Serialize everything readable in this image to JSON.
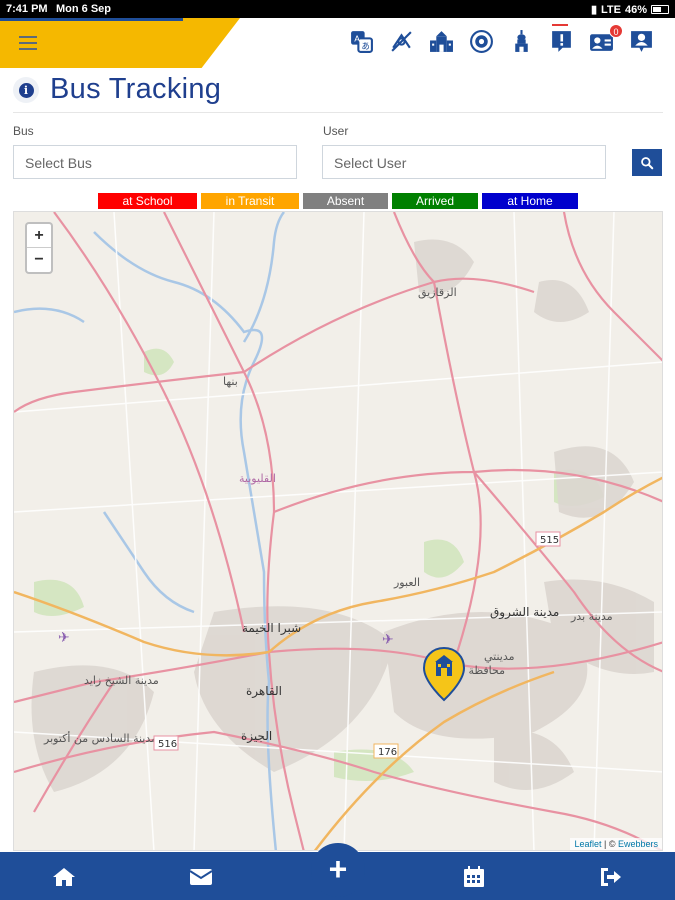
{
  "status_bar": {
    "time": "7:41 PM",
    "date": "Mon 6 Sep",
    "network": "LTE",
    "battery": "46%"
  },
  "header": {
    "menu_icon": "hamburger-icon",
    "icons": [
      "translate-icon",
      "no-transport-icon",
      "school-building-icon",
      "settings-icon",
      "mosque-icon",
      "alert-icon",
      "contact-card-icon",
      "profile-icon"
    ],
    "contact_badge": "0",
    "accent_color": "#f5b800",
    "brand_color": "#1f4e99"
  },
  "page": {
    "title": "Bus Tracking",
    "info_icon": "i"
  },
  "filters": {
    "bus_label": "Bus",
    "bus_placeholder": "Select Bus",
    "user_label": "User",
    "user_placeholder": "Select User",
    "search_icon": "search-icon"
  },
  "legend": [
    {
      "label": "at School",
      "color": "#ff0000"
    },
    {
      "label": "in Transit",
      "color": "#ffa500"
    },
    {
      "label": "Absent",
      "color": "#808080"
    },
    {
      "label": "Arrived",
      "color": "#008000"
    },
    {
      "label": "at Home",
      "color": "#0000cd"
    }
  ],
  "map": {
    "zoom_in": "+",
    "zoom_out": "−",
    "attribution_leaflet": "Leaflet",
    "attribution_sep": " | © ",
    "attribution_provider": "Ewebbers",
    "places": {
      "zagazig": "الزقازيق",
      "banha": "بنها",
      "qalyubia": "القليوبية",
      "shubra": "شبرا الخيمة",
      "cairo": "القاهرة",
      "giza": "الجيزة",
      "obour": "العبور",
      "shorouk": "مدينة الشروق",
      "sheikh_zayed": "مدينة الشيخ زايد",
      "october": "مدينة السادس من أكتوبر",
      "madinaty": "مدينتي",
      "badr": "مدينة بدر",
      "new_cairo": "محافظة القاهرة",
      "route_515": "515",
      "route_516": "516",
      "route_176": "176"
    }
  },
  "bottom_nav": {
    "items": [
      "home-icon",
      "mail-icon",
      "calendar-icon",
      "logout-icon"
    ],
    "fab_label": "+"
  }
}
